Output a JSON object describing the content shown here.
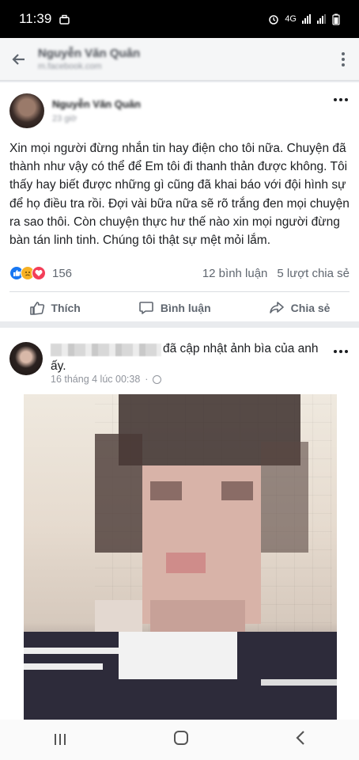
{
  "status_bar": {
    "time": "11:39",
    "network": "4G"
  },
  "header": {
    "name": "Nguyễn Văn Quân",
    "subtitle": "m.facebook.com"
  },
  "post1": {
    "author": "Nguyễn Văn Quân",
    "time": "23 giờ",
    "text": "Xin mọi người đừng nhắn tin hay điện cho tôi nữa. Chuyện đã thành như vậy có thể để Em tôi đi thanh thản được không. Tôi thấy hay biết được những gì cũng đã khai báo với đội hình sự để họ điều tra rồi. Đợi vài bữa nữa sẽ rõ trắng đen mọi chuyện ra sao thôi. Còn chuyện thực hư thế nào xin mọi người đừng bàn tán linh tinh. Chúng tôi thật sự mệt mỏi lắm.",
    "reaction_count": "156",
    "comments": "12 bình luận",
    "shares": "5 lượt chia sẻ",
    "actions": {
      "like": "Thích",
      "comment": "Bình luận",
      "share": "Chia sẻ"
    }
  },
  "post2": {
    "headline": "đã cập nhật ảnh bìa của anh ấy.",
    "time": "16 tháng 4 lúc 00:38"
  }
}
